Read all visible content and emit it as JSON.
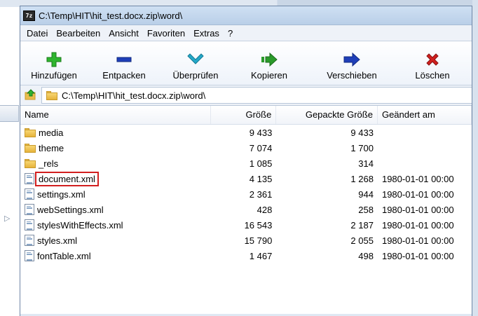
{
  "window": {
    "title": "C:\\Temp\\HIT\\hit_test.docx.zip\\word\\",
    "app_icon": "7z"
  },
  "menu": [
    "Datei",
    "Bearbeiten",
    "Ansicht",
    "Favoriten",
    "Extras",
    "?"
  ],
  "toolbar": [
    {
      "label": "Hinzufügen",
      "icon": "plus-icon",
      "color": "#2fb52f"
    },
    {
      "label": "Entpacken",
      "icon": "minus-icon",
      "color": "#1f3fb8"
    },
    {
      "label": "Überprüfen",
      "icon": "check-chevron-icon",
      "color": "#24a9c9"
    },
    {
      "label": "Kopieren",
      "icon": "copy-arrow-icon",
      "color": "#2a9a2a"
    },
    {
      "label": "Verschieben",
      "icon": "move-arrow-icon",
      "color": "#1f3fb8"
    },
    {
      "label": "Löschen",
      "icon": "delete-x-icon",
      "color": "#d0201e"
    }
  ],
  "address": {
    "path": "C:\\Temp\\HIT\\hit_test.docx.zip\\word\\"
  },
  "columns": {
    "name": "Name",
    "size": "Größe",
    "packed": "Gepackte Größe",
    "modified": "Geändert am"
  },
  "files": [
    {
      "name": "media",
      "type": "folder",
      "size": "9 433",
      "packed": "9 433",
      "modified": ""
    },
    {
      "name": "theme",
      "type": "folder",
      "size": "7 074",
      "packed": "1 700",
      "modified": ""
    },
    {
      "name": "_rels",
      "type": "folder",
      "size": "1 085",
      "packed": "314",
      "modified": ""
    },
    {
      "name": "document.xml",
      "type": "file",
      "size": "4 135",
      "packed": "1 268",
      "modified": "1980-01-01 00:00",
      "highlighted": true
    },
    {
      "name": "settings.xml",
      "type": "file",
      "size": "2 361",
      "packed": "944",
      "modified": "1980-01-01 00:00"
    },
    {
      "name": "webSettings.xml",
      "type": "file",
      "size": "428",
      "packed": "258",
      "modified": "1980-01-01 00:00"
    },
    {
      "name": "stylesWithEffects.xml",
      "type": "file",
      "size": "16 543",
      "packed": "2 187",
      "modified": "1980-01-01 00:00"
    },
    {
      "name": "styles.xml",
      "type": "file",
      "size": "15 790",
      "packed": "2 055",
      "modified": "1980-01-01 00:00"
    },
    {
      "name": "fontTable.xml",
      "type": "file",
      "size": "1 467",
      "packed": "498",
      "modified": "1980-01-01 00:00"
    }
  ],
  "colors": {
    "highlight_box": "#d21f1f",
    "window_frame": "#6f86a6"
  }
}
